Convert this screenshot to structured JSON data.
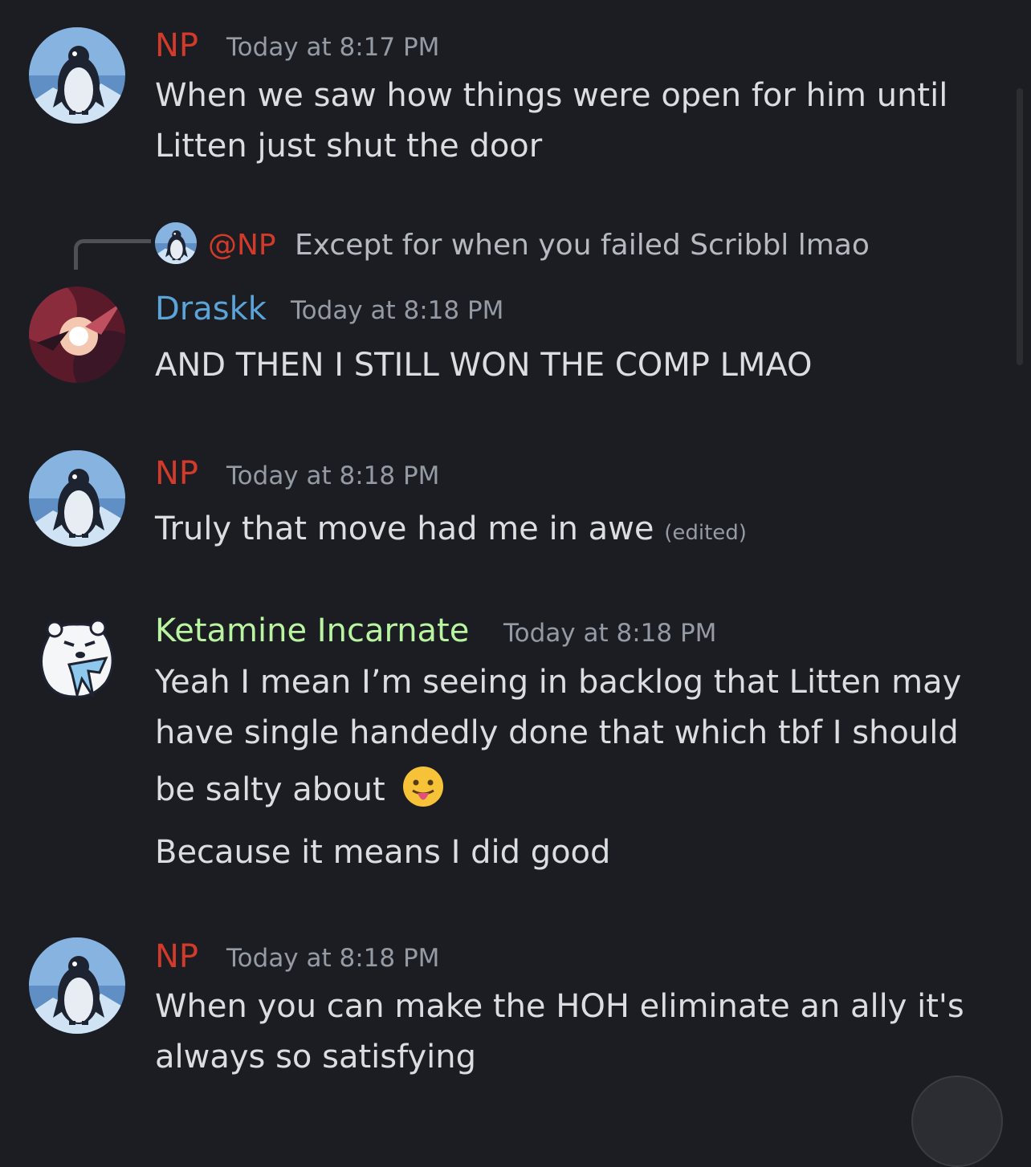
{
  "colors": {
    "background": "#1c1d22",
    "np": "#d23a2a",
    "draskk": "#5aa4d8",
    "ketamine": "#b9f5a0",
    "timestamp": "#949ba4",
    "text": "#dbdee1"
  },
  "messages": [
    {
      "author": "NP",
      "time": "Today at 8:17 PM",
      "avatar_icon": "penguin-avatar",
      "lines": [
        "When we saw how things were open for him until",
        "Litten just shut the door"
      ]
    },
    {
      "reply": {
        "mention": "@NP",
        "text": "Except for when you failed Scribbl lmao",
        "avatar_icon": "penguin-avatar"
      },
      "author": "Draskk",
      "time": "Today at 8:18 PM",
      "avatar_icon": "explosion-art-avatar",
      "lines": [
        "AND THEN I STILL WON THE COMP LMAO"
      ]
    },
    {
      "author": "NP",
      "time": "Today at 8:18 PM",
      "avatar_icon": "penguin-avatar",
      "lines": [
        "Truly that move had me in awe"
      ],
      "edited": "(edited)"
    },
    {
      "author": "Ketamine Incarnate",
      "time": "Today at 8:18 PM",
      "avatar_icon": "polar-bear-avatar",
      "lines": [
        "Yeah I mean I’m seeing in backlog that Litten may",
        "have single handedly done that which tbf I should",
        "be salty about"
      ],
      "emoji": "tongue-out-emoji",
      "followup": "Because it means I did good"
    },
    {
      "author": "NP",
      "time": "Today at 8:18 PM",
      "avatar_icon": "penguin-avatar",
      "lines": [
        "When you can make the HOH eliminate an ally it's",
        "always so satisfying"
      ]
    }
  ]
}
